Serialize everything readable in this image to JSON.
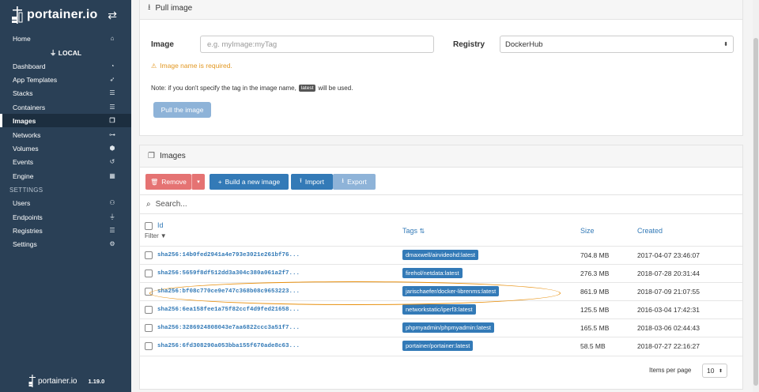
{
  "sidebar": {
    "brand": "portainer.io",
    "endpoint": "LOCAL",
    "items": [
      {
        "label": "Home",
        "icon": "home-icon",
        "glyph": "⌂"
      },
      {
        "label": "Dashboard",
        "icon": "tachometer-icon",
        "glyph": "◔"
      },
      {
        "label": "App Templates",
        "icon": "rocket-icon",
        "glyph": "➶"
      },
      {
        "label": "Stacks",
        "icon": "th-list-icon",
        "glyph": "☰"
      },
      {
        "label": "Containers",
        "icon": "server-icon",
        "glyph": "☰"
      },
      {
        "label": "Images",
        "icon": "clone-icon",
        "glyph": "❐"
      },
      {
        "label": "Networks",
        "icon": "sitemap-icon",
        "glyph": "⊶"
      },
      {
        "label": "Volumes",
        "icon": "cubes-icon",
        "glyph": "⬢"
      },
      {
        "label": "Events",
        "icon": "history-icon",
        "glyph": "↺"
      },
      {
        "label": "Engine",
        "icon": "th-icon",
        "glyph": "▦"
      }
    ],
    "settings_header": "SETTINGS",
    "settings_items": [
      {
        "label": "Users",
        "icon": "users-icon",
        "glyph": "👥"
      },
      {
        "label": "Endpoints",
        "icon": "plug-icon",
        "glyph": "⏚"
      },
      {
        "label": "Registries",
        "icon": "database-icon",
        "glyph": "☰"
      },
      {
        "label": "Settings",
        "icon": "cogs-icon",
        "glyph": "⚙"
      }
    ],
    "footer_brand": "portainer.io",
    "version": "1.19.0"
  },
  "pull": {
    "title": "Pull image",
    "image_label": "Image",
    "image_placeholder": "e.g. myImage:myTag",
    "registry_label": "Registry",
    "registry_value": "DockerHub",
    "warning": "Image name is required.",
    "note_before": "Note: if you don't specify the tag in the image name,",
    "note_badge": "latest",
    "note_after": "will be used.",
    "button": "Pull the image"
  },
  "images": {
    "title": "Images",
    "buttons": {
      "remove": "Remove",
      "build": "Build a new image",
      "import": "Import",
      "export": "Export"
    },
    "search_placeholder": "Search...",
    "columns": {
      "id": "Id",
      "filter": "Filter",
      "tags": "Tags",
      "size": "Size",
      "created": "Created"
    },
    "rows": [
      {
        "id": "sha256:14b0fed2941a4e793e3021e261bf76...",
        "tag": "dmaxwell/airvideohd:latest",
        "size": "704.8 MB",
        "created": "2017-04-07 23:46:07"
      },
      {
        "id": "sha256:5659f8df512dd3a304c380a061a2f7...",
        "tag": "firehol/netdata:latest",
        "size": "276.3 MB",
        "created": "2018-07-28 20:31:44"
      },
      {
        "id": "sha256:bf08c770ce9e747c368b08c9653223...",
        "tag": "jarischaefer/docker-librenms:latest",
        "size": "861.9 MB",
        "created": "2018-07-09 21:07:55"
      },
      {
        "id": "sha256:6ea158fee1a75f82ccf4d9fed21658...",
        "tag": "networkstatic/iperf3:latest",
        "size": "125.5 MB",
        "created": "2016-03-04 17:42:31"
      },
      {
        "id": "sha256:3286924808043e7aa6822ccc3a51f7...",
        "tag": "phpmyadmin/phpmyadmin:latest",
        "size": "165.5 MB",
        "created": "2018-03-06 02:44:43"
      },
      {
        "id": "sha256:6fd308290a053bba155f670ade8c63...",
        "tag": "portainer/portainer:latest",
        "size": "58.5 MB",
        "created": "2018-07-27 22:16:27"
      }
    ],
    "items_per_page_label": "Items per page",
    "items_per_page_value": "10"
  },
  "colors": {
    "sidebar": "#2a4056",
    "primary": "#337ab7",
    "danger": "#e57373",
    "warning": "#e29823",
    "highlight": "#e8900e"
  }
}
